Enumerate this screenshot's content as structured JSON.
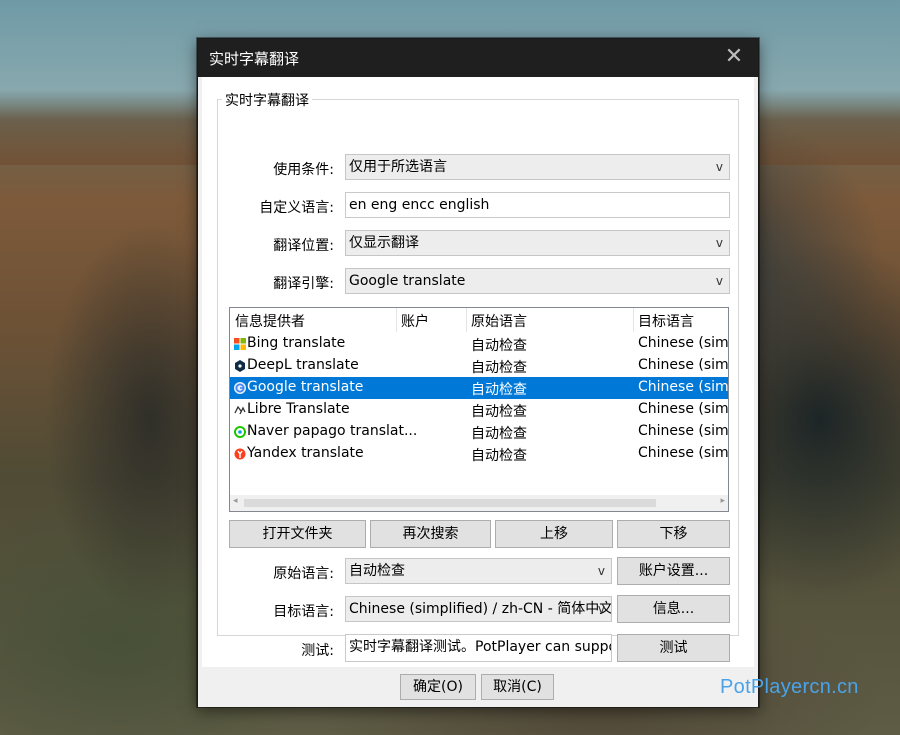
{
  "window": {
    "title": "实时字幕翻译",
    "close_glyph": "✕"
  },
  "group_title": "实时字幕翻译",
  "form": {
    "condition_label": "使用条件:",
    "condition_value": "仅用于所选语言",
    "custom_lang_label": "自定义语言:",
    "custom_lang_value": "en eng encc english",
    "position_label": "翻译位置:",
    "position_value": "仅显示翻译",
    "engine_label": "翻译引擎:",
    "engine_value": "Google translate",
    "dropdown_arrow": "v"
  },
  "table": {
    "headers": [
      "信息提供者",
      "账户",
      "原始语言",
      "目标语言"
    ],
    "rows": [
      {
        "provider": "Bing translate",
        "account": "",
        "source": "自动检查",
        "target": "Chinese (simpli",
        "icon": "bing-icon",
        "selected": false
      },
      {
        "provider": "DeepL translate",
        "account": "",
        "source": "自动检查",
        "target": "Chinese (simpli",
        "icon": "deepl-icon",
        "selected": false
      },
      {
        "provider": "Google translate",
        "account": "",
        "source": "自动检查",
        "target": "Chinese (simpli",
        "icon": "google-icon",
        "selected": true
      },
      {
        "provider": "Libre Translate",
        "account": "",
        "source": "自动检查",
        "target": "Chinese (simpli",
        "icon": "libre-icon",
        "selected": false
      },
      {
        "provider": "Naver papago translat...",
        "account": "",
        "source": "自动检查",
        "target": "Chinese (simpli",
        "icon": "papago-icon",
        "selected": false
      },
      {
        "provider": "Yandex translate",
        "account": "",
        "source": "自动检查",
        "target": "Chinese (simpli",
        "icon": "yandex-icon",
        "selected": false
      }
    ],
    "scroll_left": "◂",
    "scroll_right": "▸"
  },
  "actions": {
    "open_folder": "打开文件夹",
    "search_again": "再次搜索",
    "move_up": "上移",
    "move_down": "下移"
  },
  "lang": {
    "source_label": "原始语言:",
    "source_value": "自动检查",
    "target_label": "目标语言:",
    "target_value": "Chinese (simplified) / zh-CN - 简体中文",
    "account_settings": "账户设置...",
    "info": "信息..."
  },
  "test": {
    "label": "测试:",
    "value": "实时字幕翻译测试。PotPlayer can support",
    "button": "测试"
  },
  "footer": {
    "ok": "确定(O)",
    "cancel": "取消(C)"
  },
  "watermark": "PotPlayercn.cn",
  "colors": {
    "selection": "#0078d7",
    "titlebar": "#1f1f1f",
    "watermark": "#4aa3e8"
  }
}
